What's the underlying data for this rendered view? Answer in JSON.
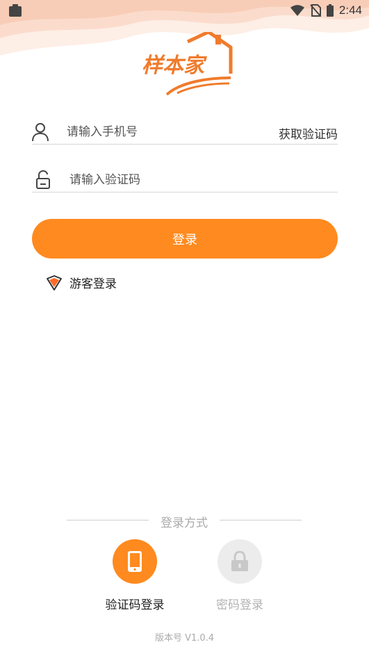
{
  "status_bar": {
    "time": "2:44",
    "icons": [
      "clipboard-icon",
      "wifi-icon",
      "no-sim-icon",
      "battery-icon"
    ]
  },
  "logo": {
    "text": "样本家",
    "icon": "house-logo"
  },
  "form": {
    "phone_placeholder": "请输入手机号",
    "get_code_label": "获取验证码",
    "code_placeholder": "请输入验证码"
  },
  "login_button": {
    "label": "登录"
  },
  "guest_login": {
    "label": "游客登录",
    "icon": "diamond-icon"
  },
  "login_methods": {
    "title": "登录方式",
    "items": [
      {
        "label": "验证码登录",
        "icon": "phone-icon",
        "active": true
      },
      {
        "label": "密码登录",
        "icon": "lock-icon",
        "active": false
      }
    ]
  },
  "version": "版本号 V1.0.4",
  "colors": {
    "accent": "#ff8a1f",
    "header_wave_1": "#fde3d5",
    "header_wave_2": "#fbd0bb",
    "inactive": "#ececec"
  }
}
